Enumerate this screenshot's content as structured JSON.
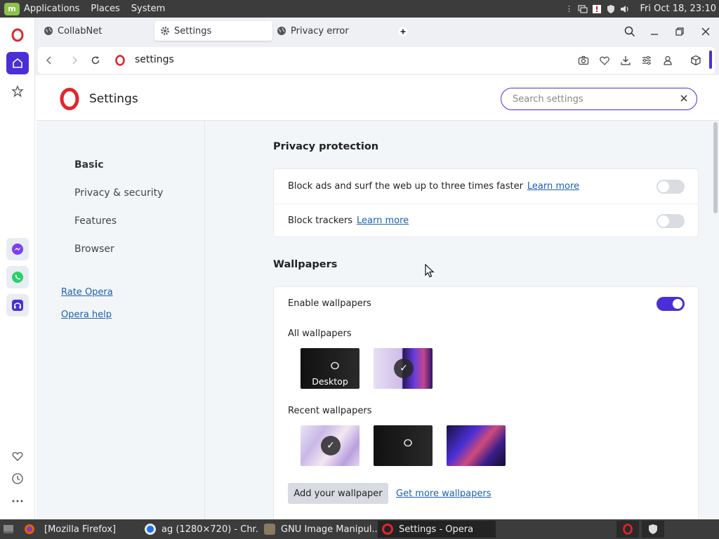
{
  "system_panel": {
    "menus": [
      "Applications",
      "Places",
      "System"
    ],
    "clock": "Fri Oct 18, 23:10"
  },
  "tabs": [
    {
      "label": "CollabNet",
      "icon": "globe-icon"
    },
    {
      "label": "Settings",
      "icon": "gear-icon"
    },
    {
      "label": "Privacy error",
      "icon": "globe-icon"
    }
  ],
  "address_bar": {
    "url": "settings"
  },
  "settings": {
    "title": "Settings",
    "search_placeholder": "Search settings",
    "nav": [
      "Basic",
      "Privacy & security",
      "Features",
      "Browser"
    ],
    "links": [
      "Rate Opera",
      "Opera help"
    ],
    "privacy": {
      "title": "Privacy protection",
      "block_ads": "Block ads and surf the web up to three times faster",
      "block_trackers": "Block trackers",
      "learn_more": "Learn more"
    },
    "wallpapers": {
      "title": "Wallpapers",
      "enable": "Enable wallpapers",
      "all": "All wallpapers",
      "desktop": "Desktop",
      "recent": "Recent wallpapers",
      "add_button": "Add your wallpaper",
      "more_link": "Get more wallpapers"
    }
  },
  "taskbar": [
    {
      "label": "[Mozilla Firefox]"
    },
    {
      "label": "ag (1280×720) - Chr..."
    },
    {
      "label": "GNU Image Manipul..."
    },
    {
      "label": "Settings - Opera"
    }
  ],
  "colors": {
    "accent": "#4a2fd6",
    "opera_red": "#e0262c",
    "link": "#1a5fb4"
  }
}
